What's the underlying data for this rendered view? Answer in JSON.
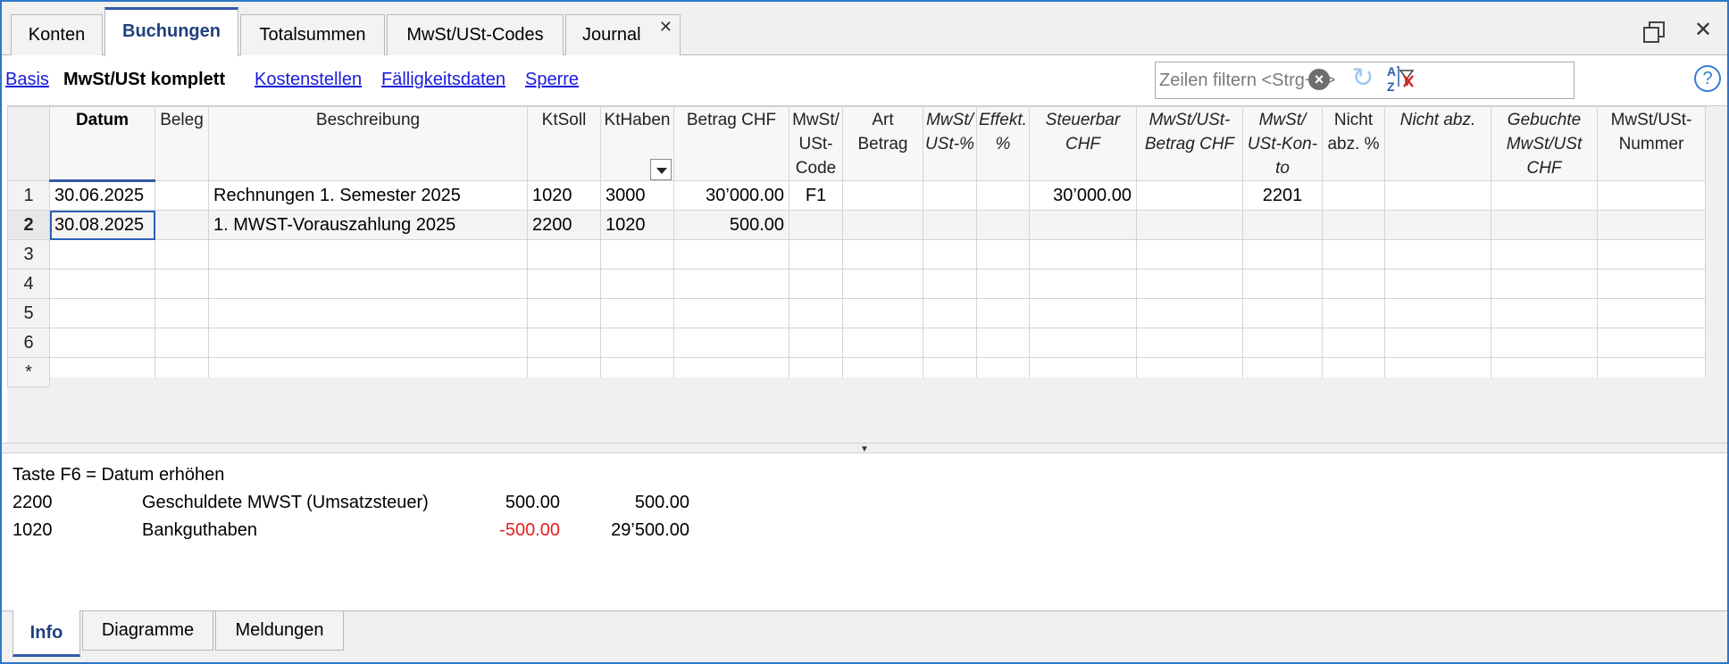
{
  "tabs": [
    {
      "label": "Konten",
      "active": false
    },
    {
      "label": "Buchungen",
      "active": true
    },
    {
      "label": "Totalsummen",
      "active": false
    },
    {
      "label": "MwSt/USt-Codes",
      "active": false
    },
    {
      "label": "Journal",
      "active": false,
      "closable": true
    }
  ],
  "window": {
    "close_glyph": "✕"
  },
  "views": [
    {
      "label": "Basis",
      "current": false
    },
    {
      "label": "MwSt/USt komplett",
      "current": true
    },
    {
      "label": "Kostenstellen",
      "current": false
    },
    {
      "label": "Fälligkeitsdaten",
      "current": false
    },
    {
      "label": "Sperre",
      "current": false
    }
  ],
  "filter": {
    "placeholder": "Zeilen filtern <Strg+L>",
    "value": ""
  },
  "icons": {
    "clear": "clear-icon",
    "refresh": "refresh-icon",
    "sort_filter": "sort-filter-icon",
    "help": "help-icon",
    "restore": "restore-icon",
    "close": "close-icon",
    "dropdown": "dropdown-icon"
  },
  "table": {
    "columns": [
      {
        "label": "Datum",
        "italic": false
      },
      {
        "label": "Beleg",
        "italic": false
      },
      {
        "label": "Beschreibung",
        "italic": false
      },
      {
        "label": "KtSoll",
        "italic": false
      },
      {
        "label": "KtHaben",
        "italic": false
      },
      {
        "label": "Betrag CHF",
        "italic": false
      },
      {
        "label": "MwSt/ USt-Code",
        "italic": false
      },
      {
        "label": "Art Betrag",
        "italic": false
      },
      {
        "label": "MwSt/ USt-%",
        "italic": true
      },
      {
        "label": "Effekt. %",
        "italic": true
      },
      {
        "label": "Steuerbar CHF",
        "italic": true
      },
      {
        "label": "MwSt/USt-Betrag CHF",
        "italic": true
      },
      {
        "label": "MwSt/ USt-Kon-to",
        "italic": true
      },
      {
        "label": "Nicht abz. %",
        "italic": false
      },
      {
        "label": "Nicht abz.",
        "italic": true
      },
      {
        "label": "Gebuchte MwSt/USt CHF",
        "italic": true
      },
      {
        "label": "MwSt/USt-Nummer",
        "italic": false
      }
    ],
    "rows": [
      {
        "num": "1",
        "cells": [
          "30.06.2025",
          "",
          "Rechnungen 1. Semester 2025",
          "1020",
          "3000",
          "30’000.00",
          "F1",
          "",
          "",
          "",
          "30’000.00",
          "",
          "2201",
          "",
          "",
          "",
          ""
        ]
      },
      {
        "num": "2",
        "cells": [
          "30.08.2025",
          "",
          "1. MWST-Vorauszahlung 2025",
          "2200",
          "1020",
          "500.00",
          "",
          "",
          "",
          "",
          "",
          "",
          "",
          "",
          "",
          "",
          ""
        ]
      },
      {
        "num": "3",
        "cells": [
          "",
          "",
          "",
          "",
          "",
          "",
          "",
          "",
          "",
          "",
          "",
          "",
          "",
          "",
          "",
          "",
          ""
        ]
      },
      {
        "num": "4",
        "cells": [
          "",
          "",
          "",
          "",
          "",
          "",
          "",
          "",
          "",
          "",
          "",
          "",
          "",
          "",
          "",
          "",
          ""
        ]
      },
      {
        "num": "5",
        "cells": [
          "",
          "",
          "",
          "",
          "",
          "",
          "",
          "",
          "",
          "",
          "",
          "",
          "",
          "",
          "",
          "",
          ""
        ]
      },
      {
        "num": "6",
        "cells": [
          "",
          "",
          "",
          "",
          "",
          "",
          "",
          "",
          "",
          "",
          "",
          "",
          "",
          "",
          "",
          "",
          ""
        ]
      },
      {
        "num": "*",
        "cells": [
          "",
          "",
          "",
          "",
          "",
          "",
          "",
          "",
          "",
          "",
          "",
          "",
          "",
          "",
          "",
          "",
          ""
        ]
      }
    ],
    "selected_row": 2
  },
  "info": {
    "hint": "Taste F6 = Datum erhöhen",
    "lines": [
      {
        "account": "2200",
        "name": "Geschuldete MWST (Umsatzsteuer)",
        "amount": "500.00",
        "balance": "500.00",
        "negative": false
      },
      {
        "account": "1020",
        "name": "Bankguthaben",
        "amount": "-500.00",
        "balance": "29’500.00",
        "negative": true
      }
    ]
  },
  "bottom_tabs": [
    {
      "label": "Info",
      "active": true
    },
    {
      "label": "Diagramme",
      "active": false
    },
    {
      "label": "Meldungen",
      "active": false
    }
  ]
}
